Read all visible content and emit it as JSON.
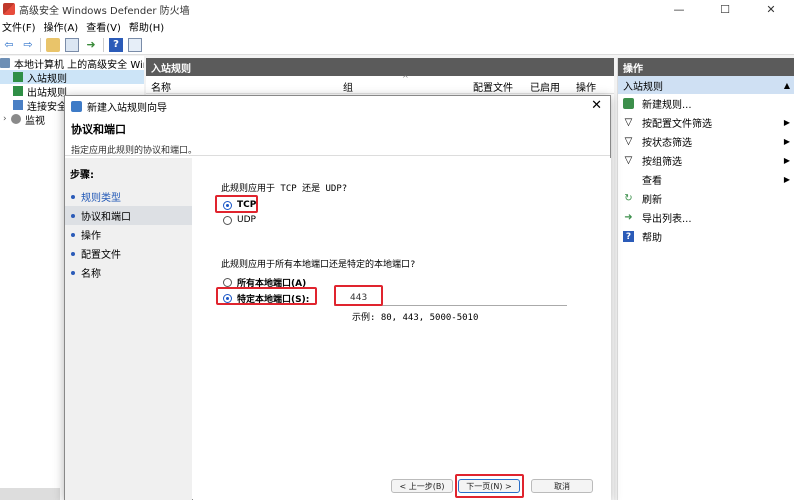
{
  "window": {
    "title": "高级安全 Windows Defender 防火墙",
    "minimize": "—",
    "maximize": "☐",
    "close": "✕"
  },
  "menu": [
    "文件(F)",
    "操作(A)",
    "查看(V)",
    "帮助(H)"
  ],
  "tree": {
    "items": [
      {
        "label": "本地计算机 上的高级安全 Windo",
        "icon": "computer-icon"
      },
      {
        "label": "入站规则",
        "icon": "inbound-rules-icon",
        "selected": true
      },
      {
        "label": "出站规则",
        "icon": "outbound-rules-icon"
      },
      {
        "label": "连接安全",
        "icon": "connection-security-icon"
      },
      {
        "label": "监视",
        "icon": "monitor-icon",
        "expander": "›"
      }
    ]
  },
  "center": {
    "header": "入站规则",
    "columns": [
      "名称",
      "组",
      "配置文件",
      "已启用",
      "操作"
    ]
  },
  "actions": {
    "header": "操作",
    "section": "入站规则",
    "section_arrow": "▲",
    "items": [
      {
        "label": "新建规则...",
        "icon": "new-rule-icon",
        "arrow": ""
      },
      {
        "label": "按配置文件筛选",
        "icon": "filter-icon",
        "arrow": "▶"
      },
      {
        "label": "按状态筛选",
        "icon": "filter-icon",
        "arrow": "▶"
      },
      {
        "label": "按组筛选",
        "icon": "filter-icon",
        "arrow": "▶"
      },
      {
        "label": "查看",
        "icon": "",
        "arrow": "▶"
      },
      {
        "label": "刷新",
        "icon": "refresh-icon",
        "arrow": ""
      },
      {
        "label": "导出列表...",
        "icon": "export-icon",
        "arrow": ""
      },
      {
        "label": "帮助",
        "icon": "help-icon",
        "arrow": ""
      }
    ]
  },
  "dialog": {
    "title": "新建入站规则向导",
    "heading": "协议和端口",
    "subheading": "指定应用此规则的协议和端口。",
    "steps_label": "步骤:",
    "steps": [
      "规则类型",
      "协议和端口",
      "操作",
      "配置文件",
      "名称"
    ],
    "q1": "此规则应用于 TCP 还是 UDP?",
    "tcp": "TCP",
    "udp": "UDP",
    "q2": "此规则应用于所有本地端口还是特定的本地端口?",
    "all_ports": "所有本地端口(A)",
    "specific_ports": "特定本地端口(S):",
    "port_value": "443",
    "example": "示例: 80, 443, 5000-5010",
    "back": "< 上一步(B)",
    "next": "下一页(N) >",
    "cancel": "取消"
  }
}
